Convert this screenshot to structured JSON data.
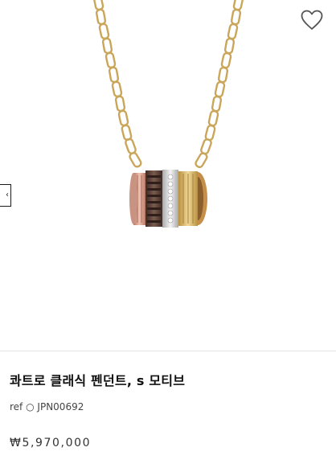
{
  "product": {
    "title": "콰트로 클래식 펜던트, s 모티브",
    "ref_label": "ref",
    "ref_separator": "○",
    "ref_code": "JPN00692",
    "price": "₩5,970,000"
  },
  "gallery": {
    "prev_arrow_glyph": "‹"
  },
  "icons": {
    "wishlist": "heart-outline-icon"
  },
  "colors": {
    "gold": "#d8b36a",
    "rose_gold": "#d9a08d",
    "brown": "#5e4038",
    "white_gold": "#d8d8d8",
    "heart_stroke": "#555555"
  }
}
